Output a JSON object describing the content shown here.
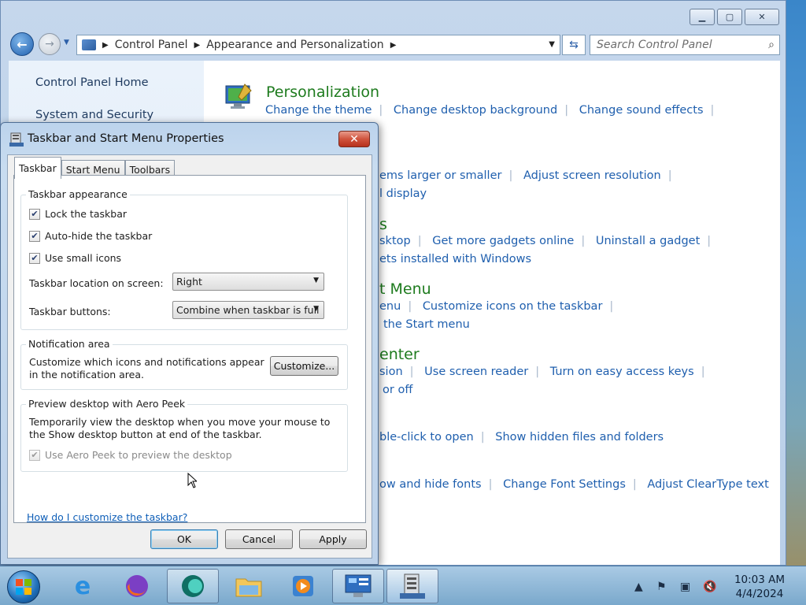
{
  "control_panel": {
    "nav": {
      "back_label": "Back",
      "forward_label": "Forward"
    },
    "breadcrumb": [
      "Control Panel",
      "Appearance and Personalization"
    ],
    "search_placeholder": "Search Control Panel",
    "window_buttons": {
      "minimize": "Minimize",
      "maximize": "Maximize",
      "close": "Close"
    },
    "sidebar": [
      "Control Panel Home",
      "System and Security"
    ],
    "categories": [
      {
        "title": "Personalization",
        "links": [
          "Change the theme",
          "Change desktop background",
          "Change sound effects"
        ]
      },
      {
        "title": "",
        "links": [
          "ems larger or smaller",
          "Adjust screen resolution"
        ]
      },
      {
        "title": "",
        "links": [
          "l display"
        ]
      },
      {
        "title": "s",
        "links": [
          "sktop",
          "Get more gadgets online",
          "Uninstall a gadget"
        ]
      },
      {
        "title": "",
        "links": [
          "ets installed with Windows"
        ]
      },
      {
        "title": "t Menu",
        "links": [
          "enu",
          "Customize icons on the taskbar"
        ]
      },
      {
        "title": "",
        "links": [
          "the Start menu"
        ]
      },
      {
        "title": "enter",
        "links": [
          "sion",
          "Use screen reader",
          "Turn on easy access keys"
        ]
      },
      {
        "title": "",
        "links": [
          "or off"
        ]
      },
      {
        "title": "",
        "links": [
          "ble-click to open",
          "Show hidden files and folders"
        ]
      },
      {
        "title": "",
        "links": [
          "ow and hide fonts",
          "Change Font Settings",
          "Adjust ClearType text"
        ]
      }
    ]
  },
  "dialog": {
    "title": "Taskbar and Start Menu Properties",
    "tabs": [
      "Taskbar",
      "Start Menu",
      "Toolbars"
    ],
    "appearance": {
      "legend": "Taskbar appearance",
      "lock": {
        "label": "Lock the taskbar",
        "checked": true
      },
      "autohide": {
        "label": "Auto-hide the taskbar",
        "checked": true
      },
      "small_icons": {
        "label": "Use small icons",
        "checked": true
      },
      "location_label": "Taskbar location on screen:",
      "location_value": "Right",
      "buttons_label": "Taskbar buttons:",
      "buttons_value": "Combine when taskbar is full"
    },
    "notification": {
      "legend": "Notification area",
      "text": "Customize which icons and notifications appear in the notification area.",
      "button": "Customize..."
    },
    "aero_peek": {
      "legend": "Preview desktop with Aero Peek",
      "text": "Temporarily view the desktop when you move your mouse to the Show desktop button at end of the taskbar.",
      "checkbox": {
        "label": "Use Aero Peek to preview the desktop",
        "checked": true,
        "disabled": true
      }
    },
    "help_link": "How do I customize the taskbar?",
    "buttons": {
      "ok": "OK",
      "cancel": "Cancel",
      "apply": "Apply"
    }
  },
  "taskbar": {
    "items": [
      "Internet Explorer",
      "Firefox",
      "Browser",
      "Windows Explorer",
      "Media Player",
      "Control Panel",
      "Taskbar Properties"
    ],
    "clock": {
      "time": "10:03 AM",
      "date": "4/4/2024"
    }
  }
}
